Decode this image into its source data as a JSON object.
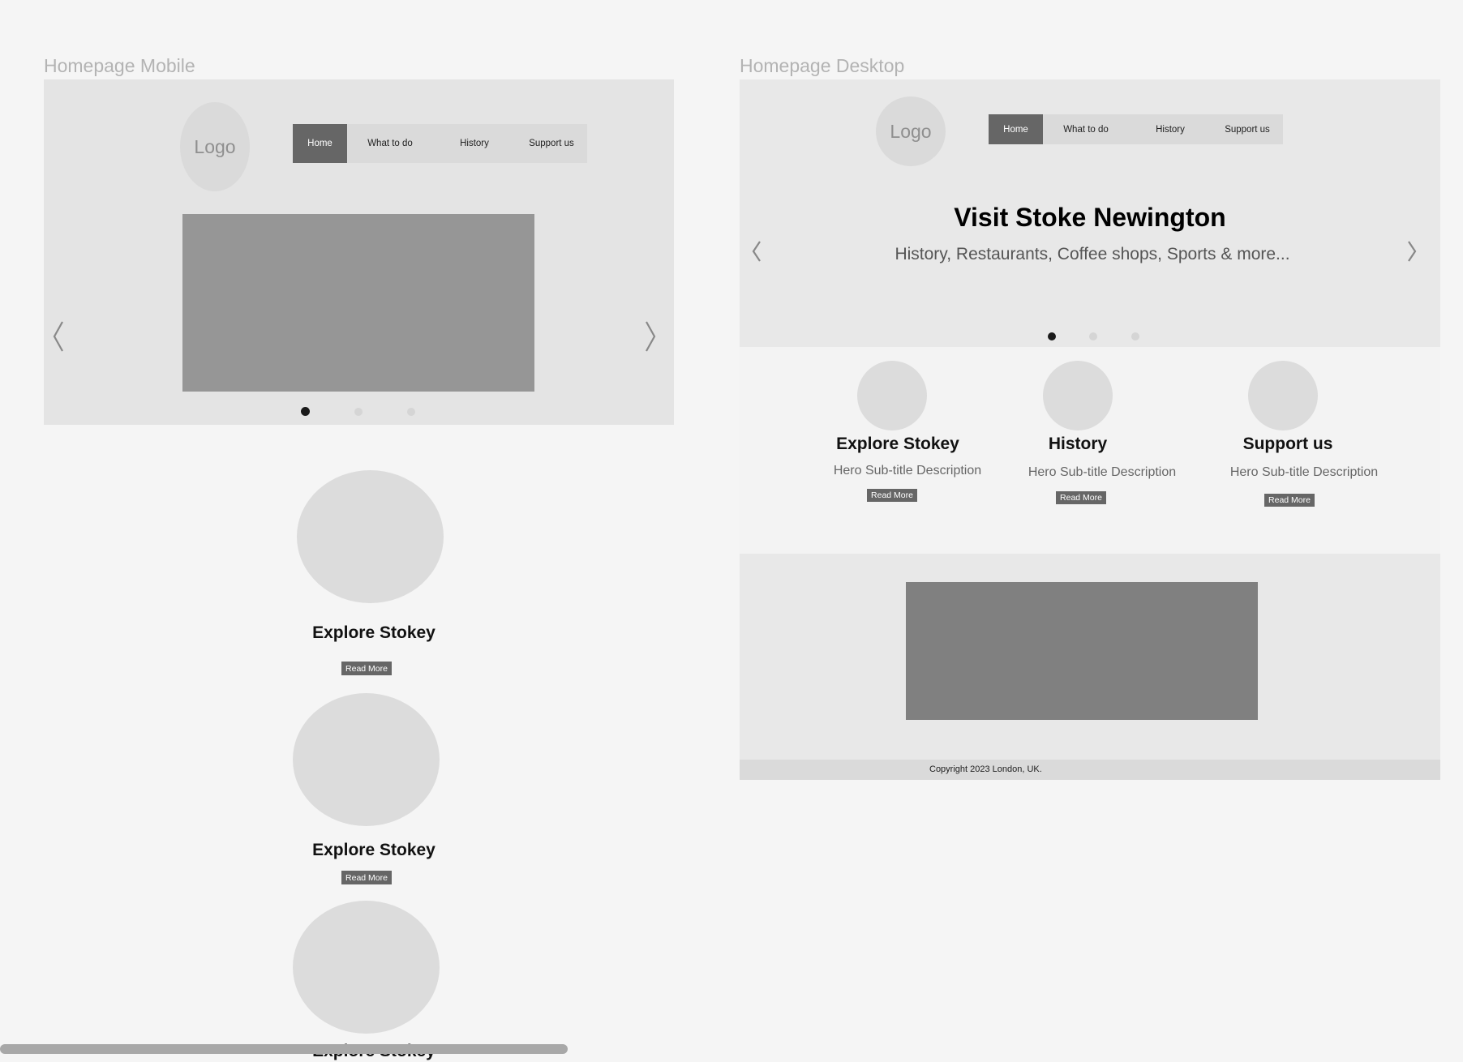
{
  "mobile": {
    "frame_title": "Homepage Mobile",
    "logo": "Logo",
    "nav": [
      {
        "label": "Home",
        "active": true
      },
      {
        "label": "What to do",
        "active": false
      },
      {
        "label": "History",
        "active": false
      },
      {
        "label": "Support us",
        "active": false
      }
    ],
    "carousel": {
      "active_index": 0,
      "count": 3,
      "prev_icon": "chevron-left-icon",
      "next_icon": "chevron-right-icon"
    },
    "cards": [
      {
        "title": "Explore Stokey",
        "button": "Read More"
      },
      {
        "title": "Explore Stokey",
        "button": "Read More"
      },
      {
        "title": "Explore Stokey"
      }
    ]
  },
  "desktop": {
    "frame_title": "Homepage Desktop",
    "logo": "Logo",
    "nav": [
      {
        "label": "Home",
        "active": true
      },
      {
        "label": "What to do",
        "active": false
      },
      {
        "label": "History",
        "active": false
      },
      {
        "label": "Support us",
        "active": false
      }
    ],
    "hero": {
      "title": "Visit Stoke Newington",
      "subtitle": "History, Restaurants, Coffee shops, Sports & more...",
      "active_index": 0,
      "count": 3,
      "prev_icon": "chevron-left-icon",
      "next_icon": "chevron-right-icon"
    },
    "features": [
      {
        "title": "Explore Stokey",
        "subtitle": "Hero Sub-title Description",
        "button": "Read More"
      },
      {
        "title": "History",
        "subtitle": "Hero Sub-title Description",
        "button": "Read More"
      },
      {
        "title": "Support us",
        "subtitle": "Hero Sub-title Description",
        "button": "Read More"
      }
    ],
    "footer": "Copyright 2023 London, UK."
  },
  "colors": {
    "canvas": "#f5f5f5",
    "panel": "#e5e5e5",
    "nav_active": "#666666",
    "image_placeholder": "#969696",
    "video_placeholder": "#808080"
  }
}
